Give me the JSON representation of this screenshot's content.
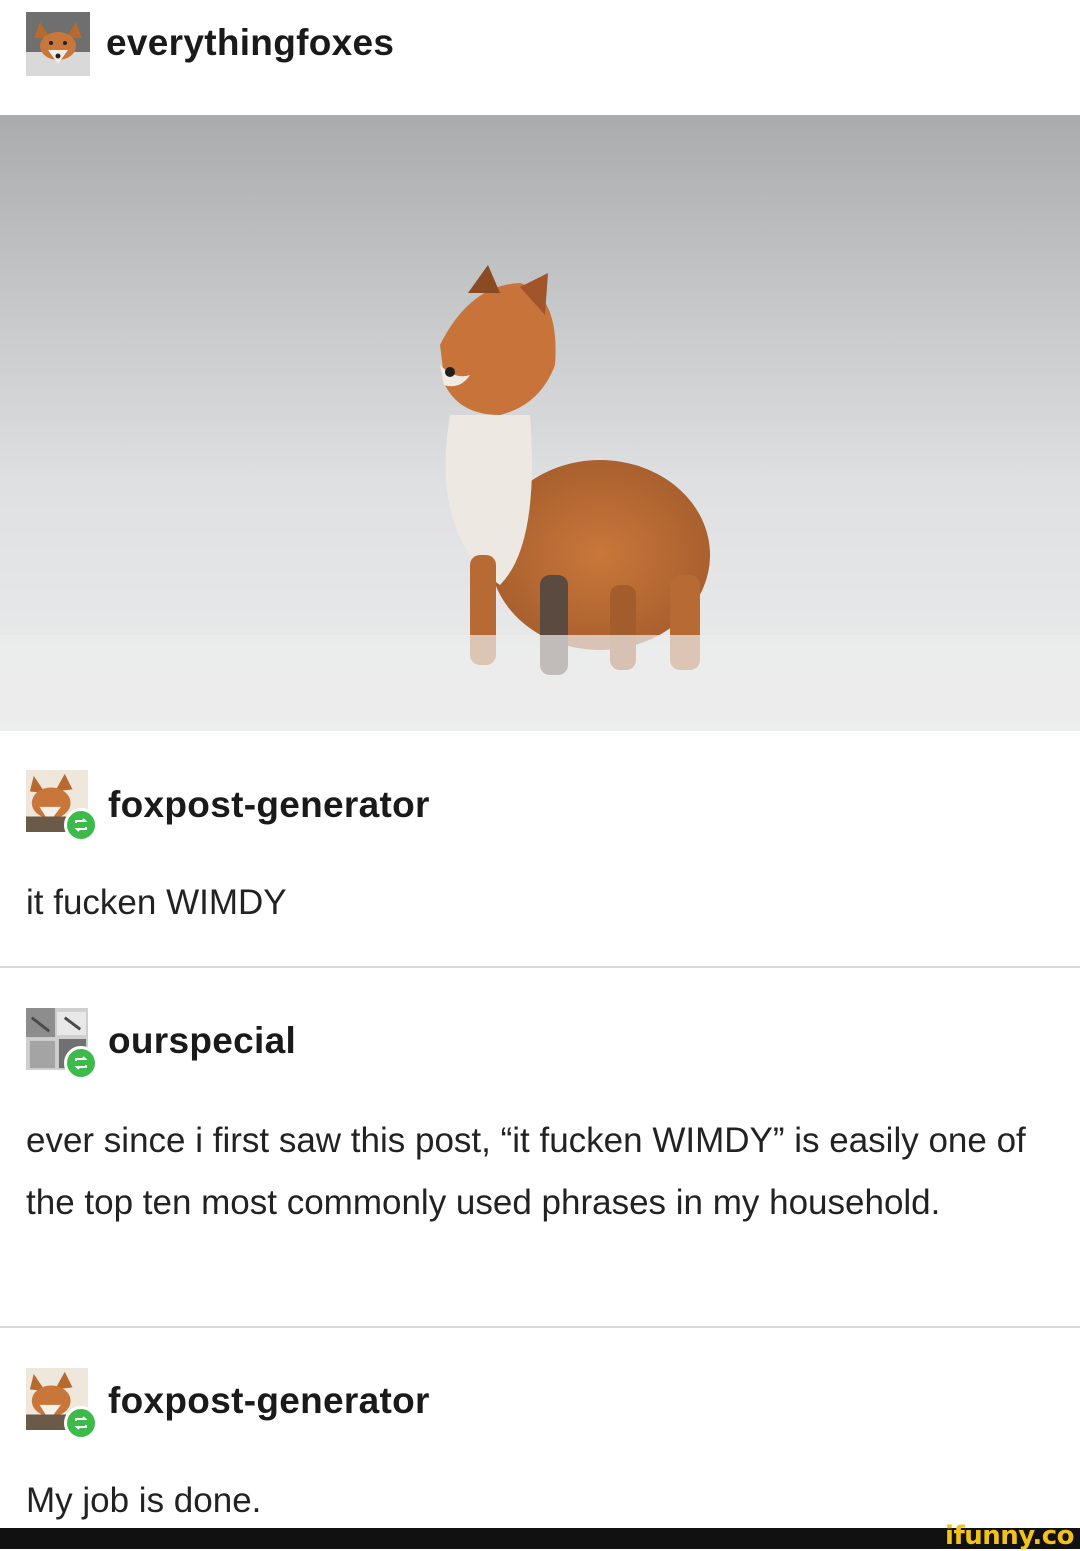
{
  "post": {
    "op": {
      "username": "everythingfoxes",
      "avatar_icon": "fox-avatar-icon"
    },
    "photo": {
      "subject_icon": "fox-photo"
    },
    "reblogs": [
      {
        "username": "foxpost-generator",
        "avatar_icon": "fox-avatar-icon",
        "badge_icon": "reblog-icon",
        "text": "it fucken WIMDY"
      },
      {
        "username": "ourspecial",
        "avatar_icon": "collage-avatar-icon",
        "badge_icon": "reblog-icon",
        "text": "ever since i first saw this post, “it fucken WIMDY” is easily one of the top ten most commonly used phrases in my household."
      },
      {
        "username": "foxpost-generator",
        "avatar_icon": "fox-avatar-icon",
        "badge_icon": "reblog-icon",
        "text": "My job is done."
      }
    ]
  },
  "watermark": {
    "text": "ifunny.co"
  },
  "colors": {
    "reblog_badge": "#3dbb4a",
    "watermark": "#f3c21a",
    "divider": "#d6d6d6",
    "fox_fur": "#c8763a"
  }
}
